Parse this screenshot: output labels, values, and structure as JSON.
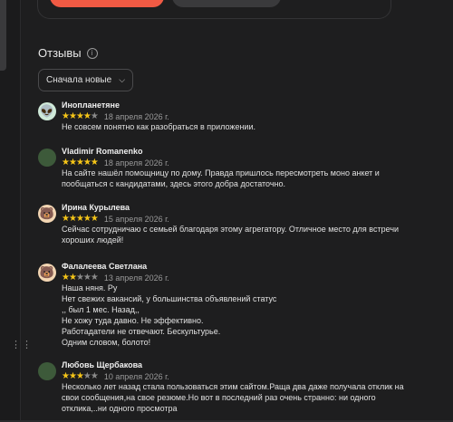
{
  "colors": {
    "accent": "#f05a44",
    "star": "#f5c518",
    "star_off": "#8a8a8a",
    "bg": "#1e1e1f"
  },
  "reviews_section": {
    "title": "Отзывы",
    "sort_label": "Сначала новые"
  },
  "reviews": [
    {
      "name": "Инопланетяне",
      "avatar": "alien-face",
      "rating": 4,
      "date": "18 апреля 2026 г.",
      "text": "Не совсем понятно как разобраться в приложении."
    },
    {
      "name": "Vladimir Romanenko",
      "avatar": "photo",
      "rating": 5,
      "date": "18 апреля 2026 г.",
      "text": "На сайте нашёл помощницу по дому. Правда пришлось пересмотреть моно анкет и\nпообщаться с кандидатами, здесь этого добра достаточно."
    },
    {
      "name": "Ирина Курылева",
      "avatar": "bear-face",
      "rating": 5,
      "date": "15 апреля 2026 г.",
      "text": "Сейчас сотрудничаю с семьей благодаря этому агрегатору. Отличное место для встречи\nхороших людей!"
    },
    {
      "name": "Фалалеева Светлана",
      "avatar": "bear-face",
      "rating": 2,
      "date": "13 апреля 2026 г.",
      "text": "Наша няня. Ру\nНет свежих вакансий, у большинства объявлений статус\n,, был 1 мес. Назад,,\nНе хожу туда давно. Не эффективно.\nРаботадатели не отвечают. Бескультурье.\nОдним словом, болото!"
    },
    {
      "name": "Любовь Щербакова",
      "avatar": "photo",
      "rating": 3,
      "date": "10 апреля 2026 г.",
      "text": "Несколько лет назад стала пользоваться этим сайтом.Раща два даже получала отклик на\nсвои сообщения,на свое резюме.Но вот в последний раз очень странно: ни одного\nотклика,..ни одного просмотра"
    }
  ]
}
